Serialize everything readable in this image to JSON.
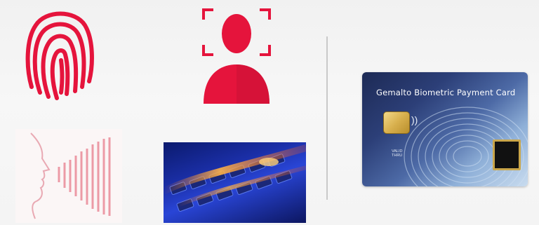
{
  "page": {
    "accent": "#e5143c",
    "divider_color": "#c9c9c9"
  },
  "icons": {
    "fingerprint": "fingerprint-icon",
    "face": "face-recognition-icon",
    "voice": "voice-recognition-icon"
  },
  "card": {
    "title": "Gemalto Biometric Payment Card",
    "valid_label": "VALID\nTHRU",
    "contactless_symbol": "))"
  }
}
